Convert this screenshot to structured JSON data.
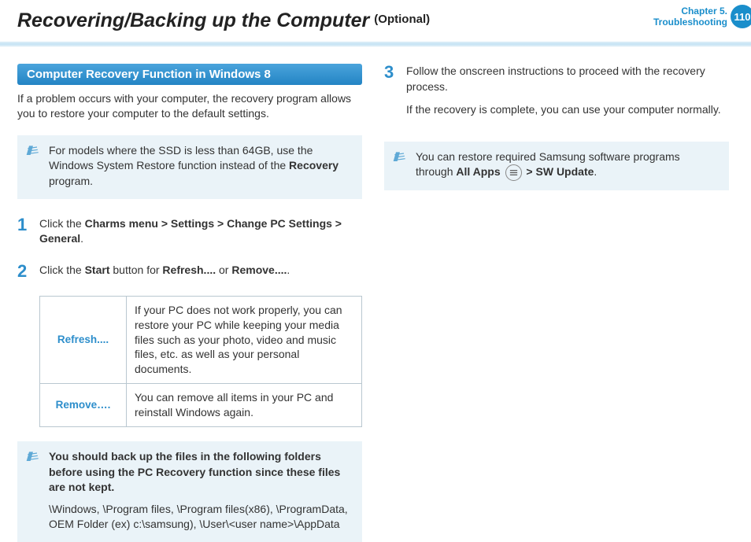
{
  "header": {
    "title": "Recovering/Backing up the Computer",
    "optional": "(Optional)",
    "chapter_line1": "Chapter 5.",
    "chapter_line2": "Troubleshooting",
    "page_number": "110"
  },
  "left": {
    "heading": "Computer Recovery Function in Windows 8",
    "intro": "If a problem occurs with your computer, the recovery program allows you to restore your computer to the default settings.",
    "note1_prefix": "For models where the SSD is less than 64GB, use the Windows System Restore function instead of the ",
    "note1_bold": "Recovery",
    "note1_suffix": " program.",
    "step1_a": "Click the ",
    "step1_b1": "Charms menu",
    "step1_sep": " > ",
    "step1_b2": "Settings",
    "step1_b3": "Change PC Settings",
    "step1_b4": "General",
    "step1_end": ".",
    "step2_a": "Click the ",
    "step2_b1": "Start",
    "step2_mid": " button for ",
    "step2_b2": "Refresh....",
    "step2_or": " or ",
    "step2_b3": "Remove....",
    "step2_end": ".",
    "table": {
      "row1_label": "Refresh....",
      "row1_desc": "If your PC does not work properly, you can restore your PC while keeping your media files such as your photo, video and music files, etc. as well as your personal documents.",
      "row2_label": "Remove….",
      "row2_desc": "You can remove all items in your PC and reinstall Windows again."
    },
    "note2_bold": "You should back up the files in the following folders before using the PC Recovery function since these files are not kept.",
    "note2_folders": "\\Windows, \\Program files, \\Program files(x86), \\ProgramData, OEM Folder (ex) c:\\samsung), \\User\\<user name>\\AppData"
  },
  "right": {
    "step3_p1": "Follow the onscreen instructions to proceed with the recovery process.",
    "step3_p2": "If the recovery is complete, you can use your computer normally.",
    "note3_a": "You can restore required Samsung software programs through ",
    "note3_b1": "All Apps",
    "note3_sep": " > ",
    "note3_b2": "SW Update",
    "note3_end": "."
  },
  "step_numbers": {
    "s1": "1",
    "s2": "2",
    "s3": "3"
  }
}
